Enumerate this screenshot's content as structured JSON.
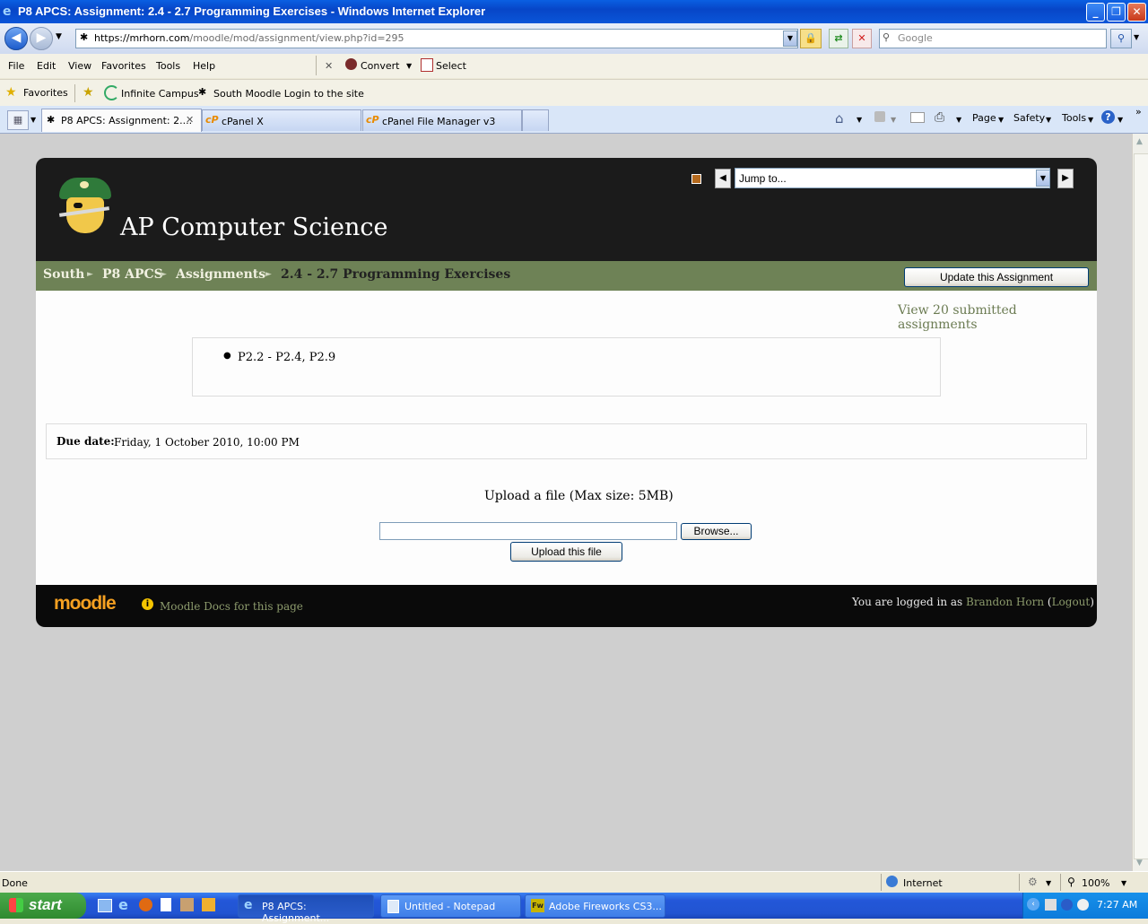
{
  "window": {
    "title": "P8 APCS: Assignment: 2.4 - 2.7 Programming Exercises - Windows Internet Explorer"
  },
  "address_bar": {
    "url_proto": "https://",
    "url_host": "mrhorn.com",
    "url_path": "/moodle/mod/assignment/view.php?id=295",
    "search_placeholder": "Google"
  },
  "menu": {
    "items": [
      "File",
      "Edit",
      "View",
      "Favorites",
      "Tools",
      "Help"
    ],
    "convert": "Convert",
    "select": "Select"
  },
  "favorites": {
    "label": "Favorites",
    "links": [
      "Infinite Campus",
      "South Moodle Login to the site"
    ]
  },
  "tabs": [
    {
      "label": "P8 APCS: Assignment: 2...."
    },
    {
      "label": "cPanel X"
    },
    {
      "label": "cPanel File Manager v3"
    }
  ],
  "command_bar": {
    "page": "Page",
    "safety": "Safety",
    "tools": "Tools"
  },
  "site": {
    "title": "AP Computer Science",
    "jump_to": "Jump to...",
    "breadcrumbs": [
      "South",
      "P8 APCS",
      "Assignments",
      "2.4 - 2.7 Programming Exercises"
    ],
    "update_button": "Update this Assignment",
    "view_submitted": "View 20 submitted assignments",
    "description_items": [
      "P2.2 - P2.4, P2.9"
    ],
    "due_label": "Due date:",
    "due_value": "Friday, 1 October 2010, 10:00 PM",
    "upload_heading": "Upload a file (Max size: 5MB)",
    "browse_button": "Browse...",
    "upload_button": "Upload this file",
    "moodle_logo": "moodle",
    "docs_link": "Moodle Docs for this page",
    "logged_in_prefix": "You are logged in as",
    "user_name": "Brandon Horn",
    "logout": "Logout"
  },
  "status_bar": {
    "status": "Done",
    "zone": "Internet",
    "zoom": "100%"
  },
  "taskbar": {
    "start": "start",
    "windows": [
      "P8 APCS: Assignment...",
      "Untitled - Notepad",
      "Adobe Fireworks CS3..."
    ],
    "clock": "7:27 AM"
  }
}
